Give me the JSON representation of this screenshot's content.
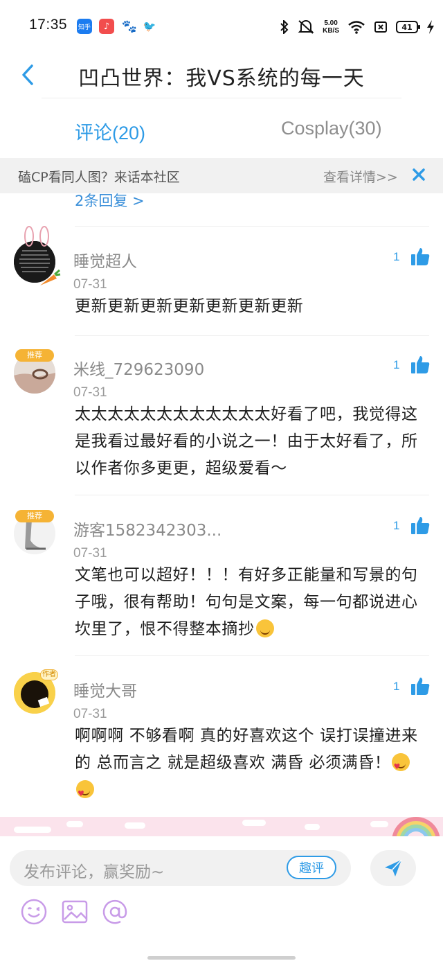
{
  "status_bar": {
    "time": "17:35",
    "apps": [
      "知乎",
      "♪",
      "🐾",
      "🐦"
    ],
    "net_speed_value": "5.00",
    "net_speed_unit": "KB/S",
    "battery": "41"
  },
  "header": {
    "title": "凹凸世界：我VS系统的每一天"
  },
  "tabs": [
    {
      "label": "评论(20)",
      "active": true
    },
    {
      "label": "Cosplay(30)",
      "active": false
    }
  ],
  "banner": {
    "text": "磕CP看同人图？来话本社区",
    "link": "查看详情>>"
  },
  "more_replies": "2条回复 >",
  "comments": [
    {
      "username": "睡觉超人",
      "date": "07-31",
      "body": "更新更新更新更新更新更新更新",
      "likes": "1"
    },
    {
      "username": "米线_729623090",
      "date": "07-31",
      "body": "太太太太太太太太太太太太好看了吧，我觉得这是我看过最好看的小说之一！由于太好看了，所以作者你多更更，超级爱看～",
      "likes": "1"
    },
    {
      "username": "游客1582342303...",
      "date": "07-31",
      "body": "文笔也可以超好！！！有好多正能量和写景的句子哦，很有帮助！句句是文案，每一句都说进心坎里了，恨不得整本摘抄",
      "likes": "1"
    },
    {
      "username": "睡觉大哥",
      "date": "07-31",
      "body": "啊啊啊 不够看啊 真的好喜欢这个 误打误撞进来的  总而言之 就是超级喜欢 满昏 必须满昏！",
      "likes": "1"
    }
  ],
  "badges": {
    "recommend": "推荐",
    "author": "作者"
  },
  "bottom": {
    "input_placeholder": "发布评论，赢奖励~",
    "qupin_label": "趣评"
  },
  "colors": {
    "accent": "#2e9be6",
    "emoji_tool": "#c89be8",
    "banner_bg": "#f1f1f1"
  }
}
